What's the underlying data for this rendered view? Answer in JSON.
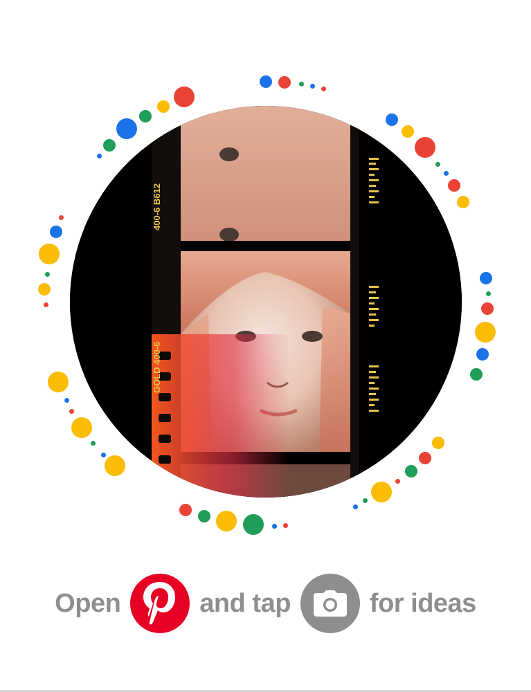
{
  "caption": {
    "word_open": "Open",
    "word_and_tap": "and tap",
    "word_for_ideas": "for ideas",
    "pinterest_icon": "pinterest-logo-icon",
    "camera_icon": "camera-icon"
  },
  "photo": {
    "film_code_top": "400-6 B612",
    "film_code_side": "GOLD 400-6"
  },
  "colors": {
    "blue": "#1a73e8",
    "red": "#ea4335",
    "yellow": "#fbbc04",
    "green": "#1e9e58",
    "pinterest_red": "#e60023",
    "caption_gray": "#8e8e8e"
  }
}
